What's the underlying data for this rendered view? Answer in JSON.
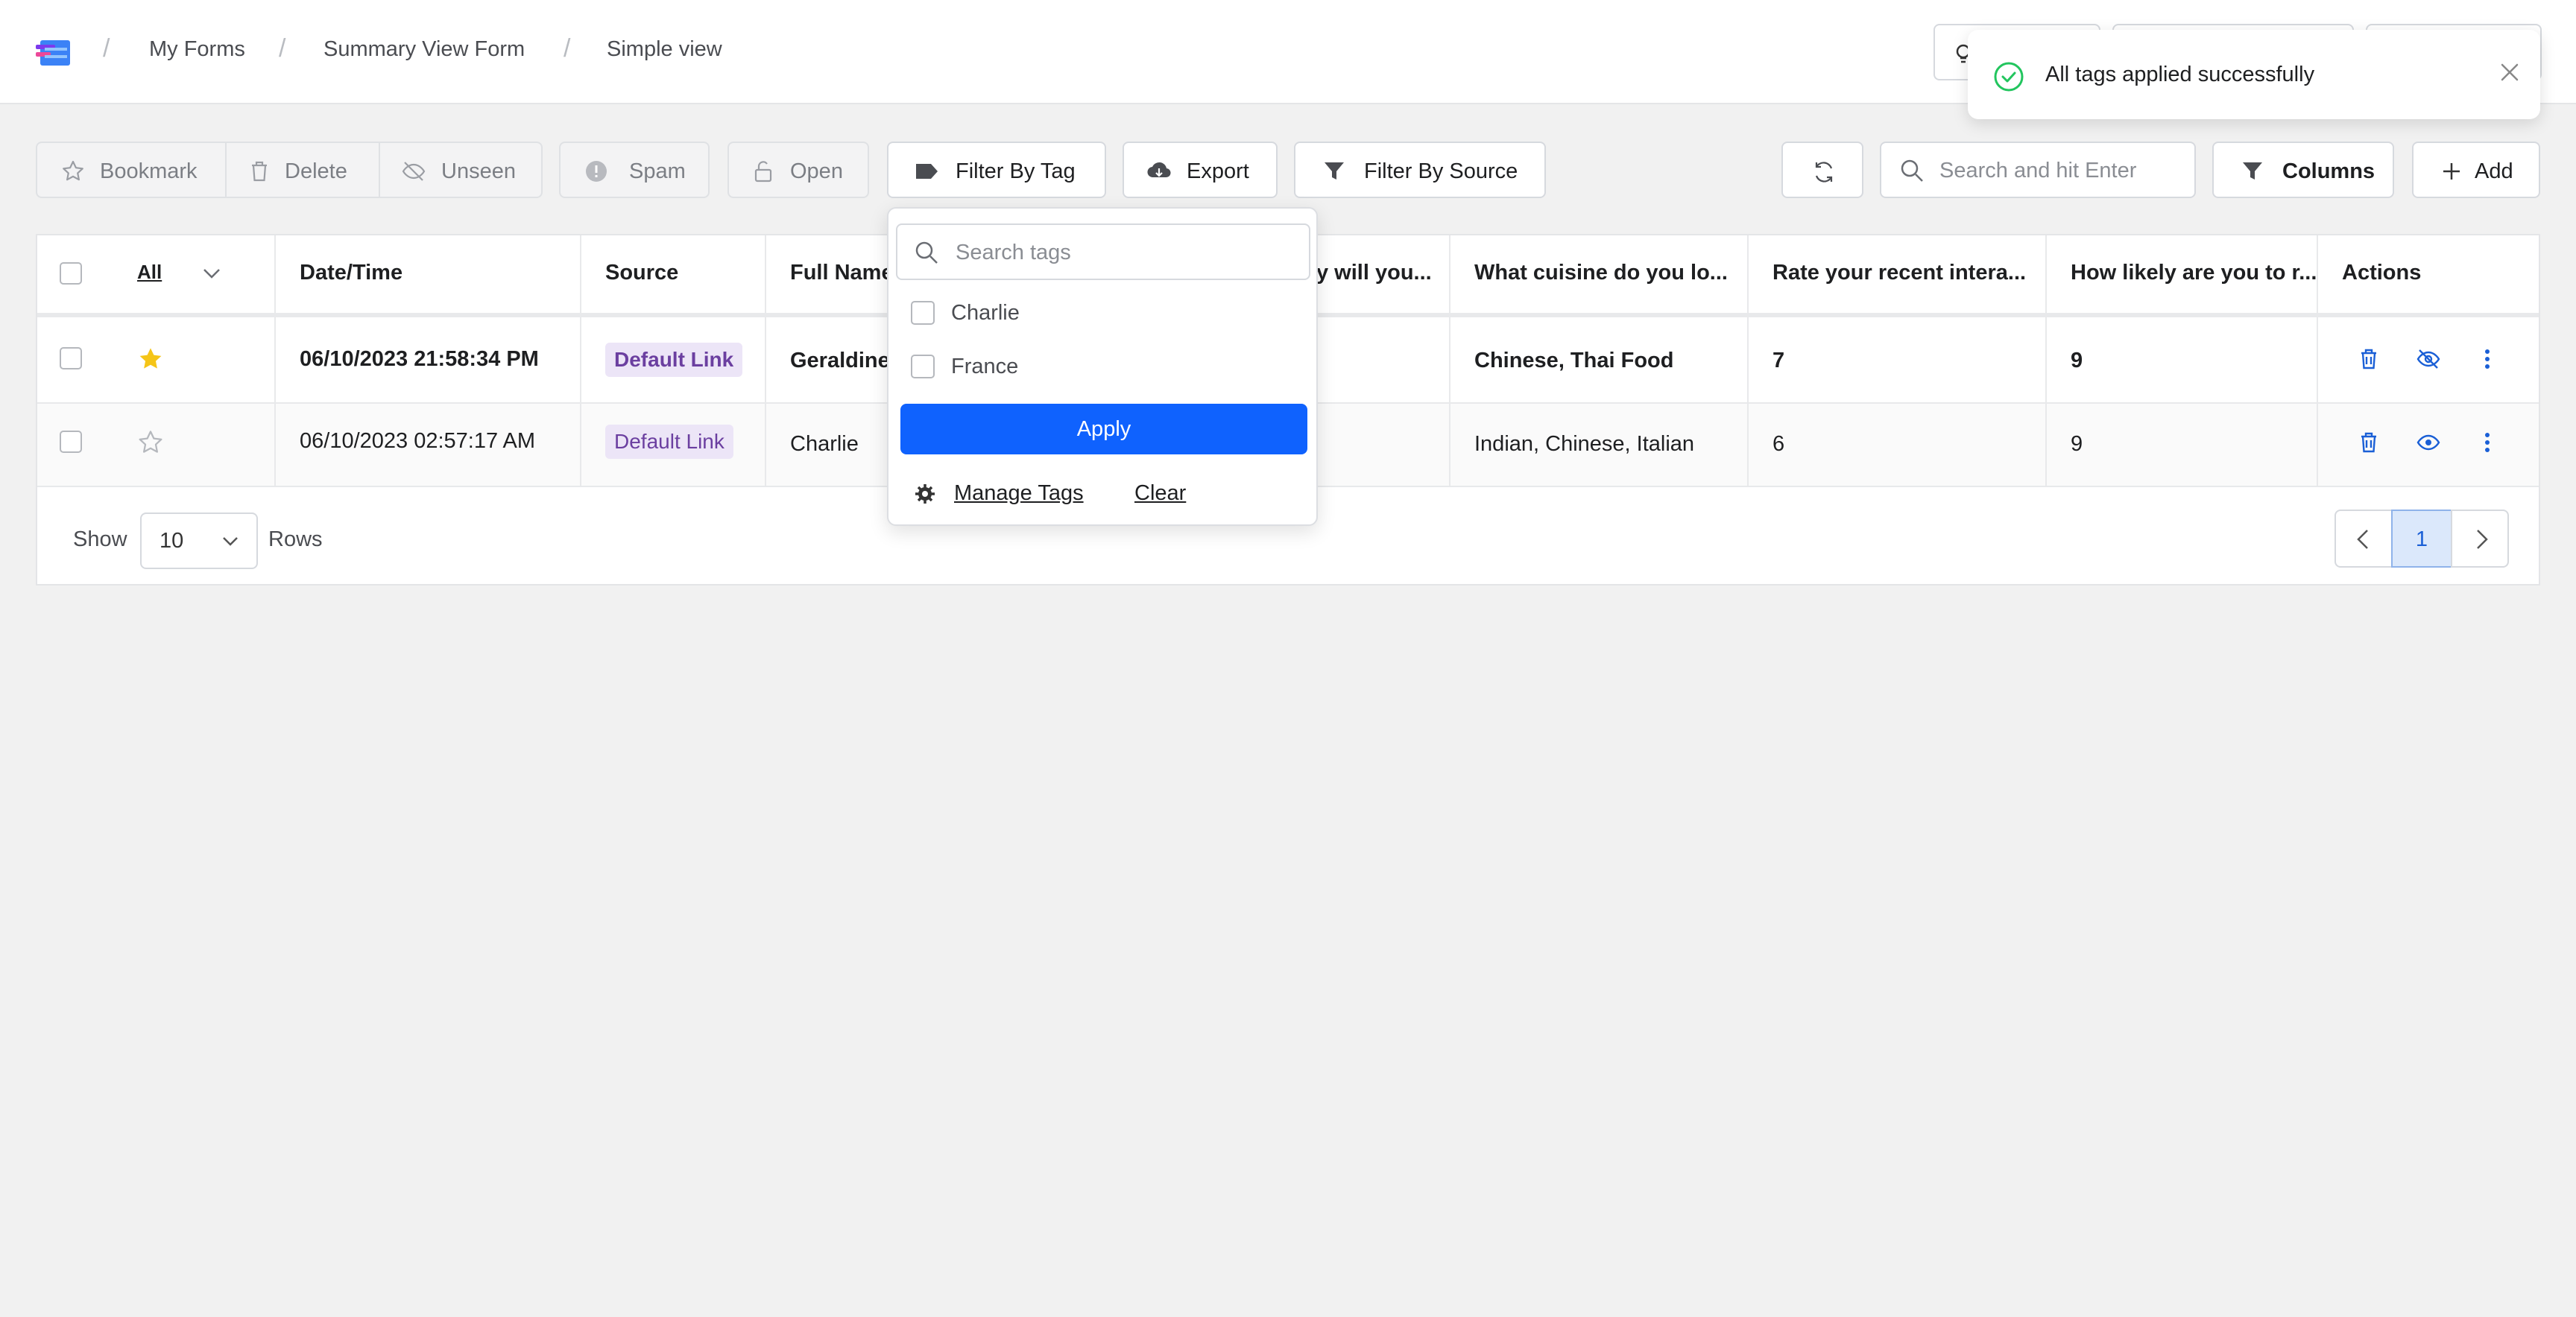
{
  "breadcrumb": [
    "My Forms",
    "Summary View Form",
    "Simple view"
  ],
  "toast": {
    "message": "All tags applied successfully",
    "status_color": "#22c55e"
  },
  "toolbar": {
    "bookmark": "Bookmark",
    "delete": "Delete",
    "unseen": "Unseen",
    "spam": "Spam",
    "open": "Open",
    "filter_by_tag": "Filter By Tag",
    "export": "Export",
    "filter_by_source": "Filter By Source",
    "search_placeholder": "Search and hit Enter",
    "columns": "Columns",
    "add": "Add"
  },
  "table": {
    "headers": {
      "all": "All",
      "datetime": "Date/Time",
      "source": "Source",
      "fullname": "Full Name",
      "q1": "y will you...",
      "q2": "What cuisine do you lo...",
      "q3": "Rate your recent intera...",
      "q4": "How likely are you to r...",
      "actions": "Actions"
    },
    "rows": [
      {
        "starred": true,
        "datetime": "06/10/2023 21:58:34 PM",
        "source": "Default Link",
        "fullname": "Geraldine",
        "cuisine": "Chinese, Thai Food",
        "rate": "7",
        "likely": "9",
        "unread": true
      },
      {
        "starred": false,
        "datetime": "06/10/2023 02:57:17 AM",
        "source": "Default Link",
        "fullname": "Charlie",
        "cuisine": "Indian, Chinese, Italian",
        "rate": "6",
        "likely": "9",
        "unread": false
      }
    ]
  },
  "footer": {
    "show": "Show",
    "rows_value": "10",
    "rows": "Rows",
    "page": "1"
  },
  "tag_dropdown": {
    "search_placeholder": "Search tags",
    "options": [
      "Charlie",
      "France"
    ],
    "apply": "Apply",
    "manage": "Manage Tags",
    "clear": "Clear"
  },
  "colors": {
    "accent": "#0f62fe",
    "star": "#f5c518",
    "badge_bg": "#ece5f7",
    "badge_text": "#6b3fa0",
    "action_icon": "#1a5fd6"
  }
}
